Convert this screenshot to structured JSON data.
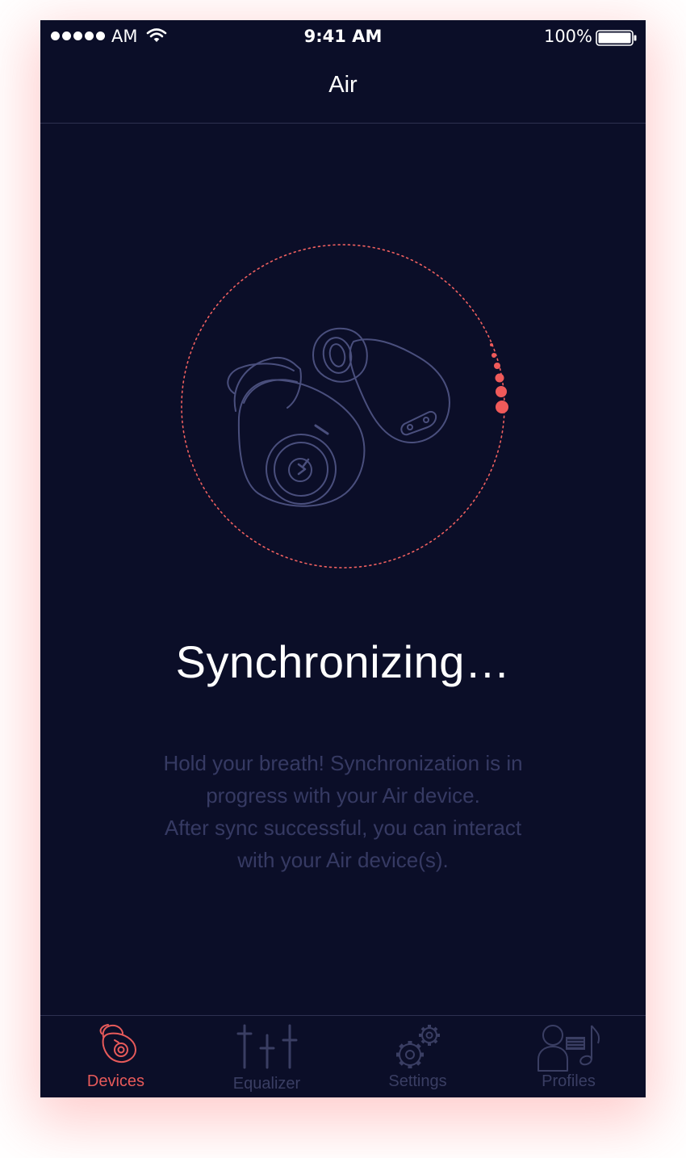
{
  "status_bar": {
    "carrier": "AM",
    "time": "9:41 AM",
    "battery": "100%"
  },
  "nav": {
    "title": "Air"
  },
  "main": {
    "title": "Synchronizing…",
    "description_lines": [
      "Hold your breath! Synchronization is in",
      "progress with your Air device.",
      "After sync successful, you can interact",
      "with your Air device(s)."
    ]
  },
  "tabs": [
    {
      "label": "Devices",
      "icon": "earbud-icon",
      "active": true
    },
    {
      "label": "Equalizer",
      "icon": "equalizer-icon",
      "active": false
    },
    {
      "label": "Settings",
      "icon": "gears-icon",
      "active": false
    },
    {
      "label": "Profiles",
      "icon": "profile-music-icon",
      "active": false
    }
  ],
  "colors": {
    "background": "#0b0e28",
    "accent": "#f05a5a",
    "muted": "#3a3e63",
    "line_art": "#4a4f7d"
  }
}
